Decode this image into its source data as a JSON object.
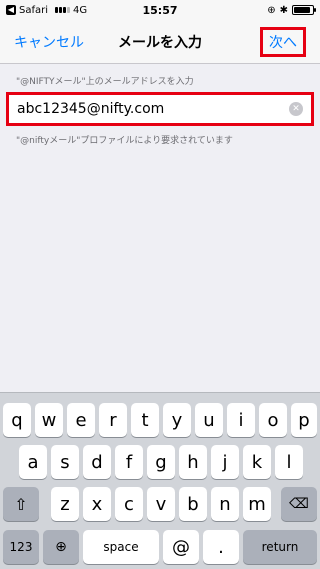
{
  "status_bar": {
    "back_app": "Safari",
    "network": "4G",
    "time": "15:57",
    "battery_level": 0.9
  },
  "nav": {
    "cancel_label": "キャンセル",
    "title": "メールを入力",
    "next_label": "次へ"
  },
  "form": {
    "label": "\"@NIFTYメール\"上のメールアドレスを入力",
    "value": "abc12345@nifty.com",
    "footer": "\"@niftyメール\"プロファイルにより要求されています"
  },
  "keyboard": {
    "row1": [
      "q",
      "w",
      "e",
      "r",
      "t",
      "y",
      "u",
      "i",
      "o",
      "p"
    ],
    "row2": [
      "a",
      "s",
      "d",
      "f",
      "g",
      "h",
      "j",
      "k",
      "l"
    ],
    "row3": [
      "z",
      "x",
      "c",
      "v",
      "b",
      "n",
      "m"
    ],
    "numbers_label": "123",
    "space_label": "space",
    "at_label": "@",
    "dot_label": ".",
    "return_label": "return",
    "icons": {
      "shift": "shift-icon",
      "delete": "delete-icon",
      "globe": "globe-icon"
    }
  }
}
